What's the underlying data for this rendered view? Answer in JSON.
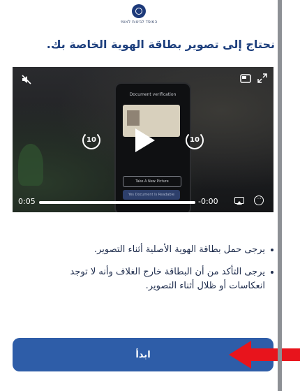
{
  "header": {
    "logo_text": "המוסד לביטוח לאומי"
  },
  "title": "نحتاج إلى تصوير بطاقة الهوية الخاصة بك.",
  "video": {
    "phone_screen_title": "Document verification",
    "phone_button_retake": "Take A New Picture",
    "phone_button_continue": "Yes Document Is Readable",
    "rewind_label": "10",
    "forward_label": "10",
    "time_current": "0:05",
    "time_remaining": "-0:00",
    "progress_fraction": 1.0
  },
  "instructions": [
    "يرجى حمل بطاقة الهوية الأصلية أثناء التصوير.",
    "يرجى التأكد من أن البطاقة خارج الغلاف وأنه لا توجد انعكاسات أو ظلال أثناء التصوير."
  ],
  "start_button": {
    "label": "ابدأ"
  },
  "colors": {
    "title": "#1d3f7d",
    "button": "#2e5da8",
    "arrow": "#e8141c"
  }
}
